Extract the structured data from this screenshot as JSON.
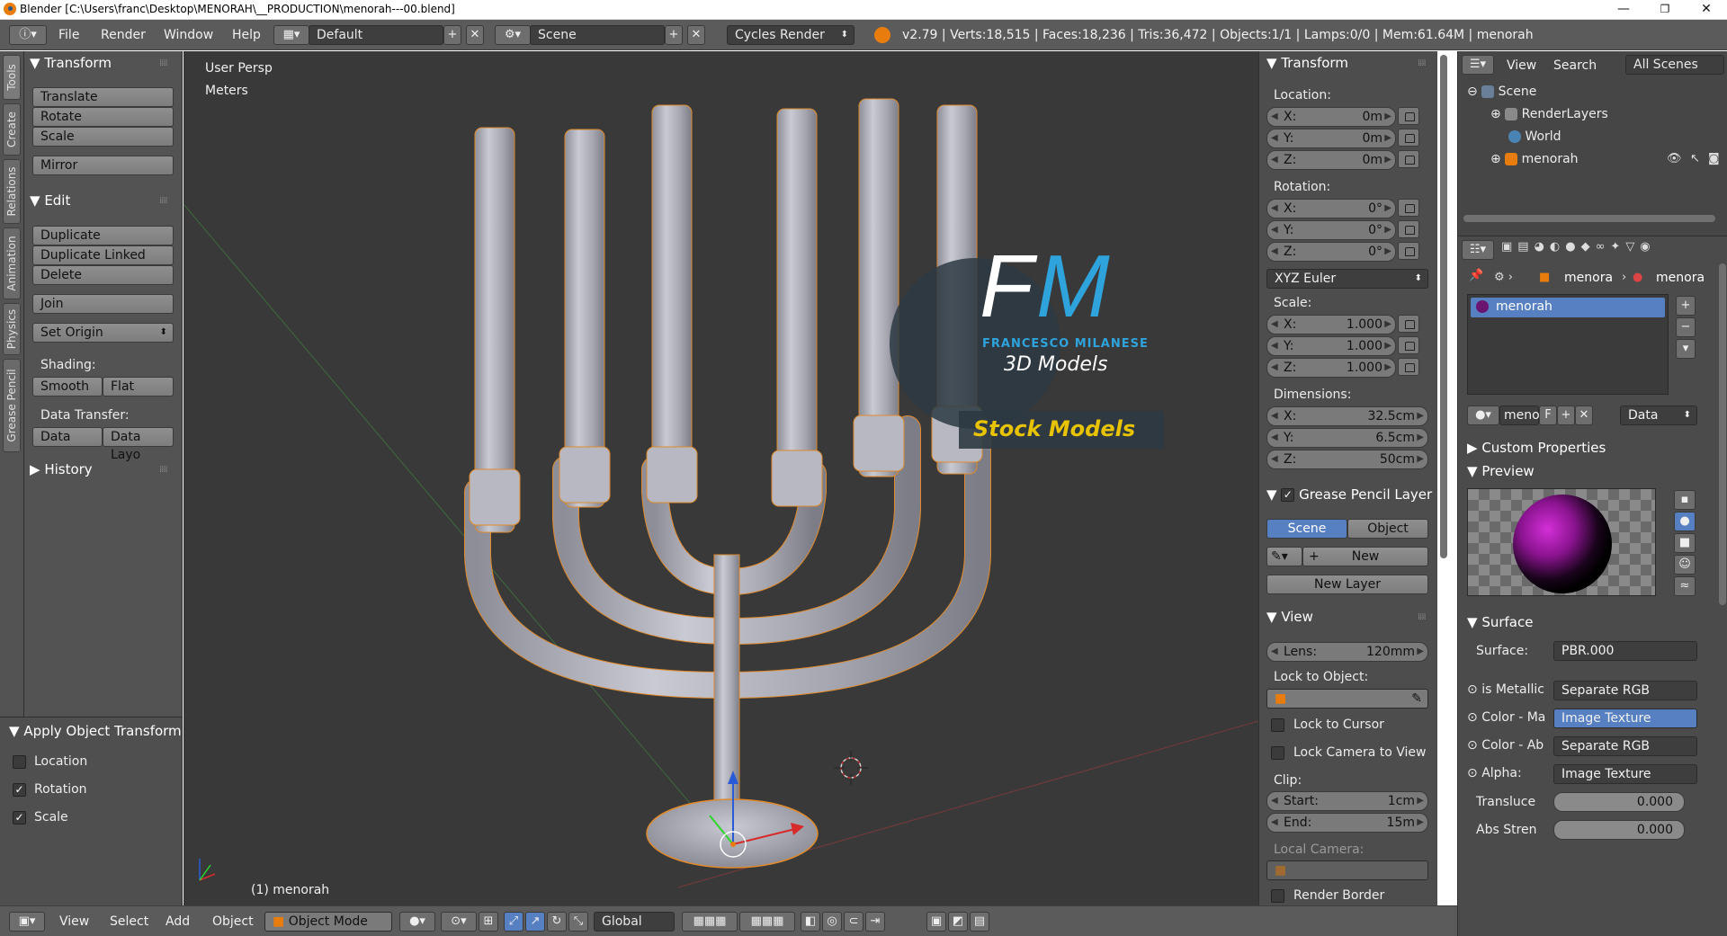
{
  "window": {
    "title": "Blender [C:\\Users\\franc\\Desktop\\MENORAH\\__PRODUCTION\\menorah---00.blend]",
    "minimize": "—",
    "maximize": "❐",
    "close": "✕"
  },
  "infobar": {
    "menus": [
      "File",
      "Render",
      "Window",
      "Help"
    ],
    "screen_layout": "Default",
    "scene": "Scene",
    "render_engine": "Cycles Render",
    "stats": "v2.79 | Verts:18,515 | Faces:18,236 | Tris:36,472 | Objects:1/1 | Lamps:0/0 | Mem:61.64M | menorah"
  },
  "tool_tabs": [
    "Tools",
    "Create",
    "Relations",
    "Animation",
    "Physics",
    "Grease Pencil"
  ],
  "toolshelf": {
    "transform_title": "Transform",
    "transform_buttons": [
      "Translate",
      "Rotate",
      "Scale"
    ],
    "mirror": "Mirror",
    "edit_title": "Edit",
    "edit_buttons": [
      "Duplicate",
      "Duplicate Linked",
      "Delete"
    ],
    "join": "Join",
    "set_origin": "Set Origin",
    "shading_label": "Shading:",
    "smooth": "Smooth",
    "flat": "Flat",
    "data_transfer_label": "Data Transfer:",
    "data": "Data",
    "data_layout": "Data Layo",
    "history": "History"
  },
  "operator": {
    "title": "Apply Object Transform",
    "options": [
      {
        "label": "Location",
        "checked": false
      },
      {
        "label": "Rotation",
        "checked": true
      },
      {
        "label": "Scale",
        "checked": true
      }
    ]
  },
  "viewport": {
    "view_name": "User Persp",
    "units": "Meters",
    "object_label": "(1) menorah",
    "watermark_initials_f": "F",
    "watermark_initials_m": "M",
    "watermark_name": "FRANCESCO MILANESE",
    "watermark_sub": "3D Models",
    "watermark_banner": "Stock Models"
  },
  "bottombar": {
    "menus": [
      "View",
      "Select",
      "Add",
      "Object"
    ],
    "mode": "Object Mode",
    "orientation": "Global"
  },
  "npanel": {
    "transform_title": "Transform",
    "location_label": "Location:",
    "location": [
      {
        "axis": "X:",
        "value": "0m"
      },
      {
        "axis": "Y:",
        "value": "0m"
      },
      {
        "axis": "Z:",
        "value": "0m"
      }
    ],
    "rotation_label": "Rotation:",
    "rotation": [
      {
        "axis": "X:",
        "value": "0°"
      },
      {
        "axis": "Y:",
        "value": "0°"
      },
      {
        "axis": "Z:",
        "value": "0°"
      }
    ],
    "rotation_mode": "XYZ Euler",
    "scale_label": "Scale:",
    "scale": [
      {
        "axis": "X:",
        "value": "1.000"
      },
      {
        "axis": "Y:",
        "value": "1.000"
      },
      {
        "axis": "Z:",
        "value": "1.000"
      }
    ],
    "dimensions_label": "Dimensions:",
    "dimensions": [
      {
        "axis": "X:",
        "value": "32.5cm"
      },
      {
        "axis": "Y:",
        "value": "6.5cm"
      },
      {
        "axis": "Z:",
        "value": "50cm"
      }
    ],
    "gp_title": "Grease Pencil Layer",
    "gp_scene": "Scene",
    "gp_object": "Object",
    "gp_new": "New",
    "gp_new_layer": "New Layer",
    "view_title": "View",
    "lens_label": "Lens:",
    "lens_value": "120mm",
    "lock_to_object": "Lock to Object:",
    "lock_to_cursor": "Lock to Cursor",
    "lock_camera": "Lock Camera to View",
    "clip_label": "Clip:",
    "clip_start_label": "Start:",
    "clip_start": "1cm",
    "clip_end_label": "End:",
    "clip_end": "15m",
    "local_camera": "Local Camera:",
    "render_border": "Render Border"
  },
  "outliner": {
    "view": "View",
    "search": "Search",
    "filter": "All Scenes",
    "items": [
      "Scene",
      "RenderLayers",
      "World",
      "menorah"
    ]
  },
  "properties": {
    "breadcrumb_obj": "menora",
    "breadcrumb_mat": "menora",
    "material_slot": "menorah",
    "mat_name": "meno",
    "mat_fake": "F",
    "link": "Data",
    "custom_props": "Custom Properties",
    "preview": "Preview",
    "surface_title": "Surface",
    "surface_label": "Surface:",
    "surface_value": "PBR.000",
    "rows": [
      {
        "label": "is Metallic",
        "value": "Separate RGB"
      },
      {
        "label": "Color - Ma",
        "value": "Image Texture"
      },
      {
        "label": "Color - Ab",
        "value": "Separate RGB"
      },
      {
        "label": "Alpha:",
        "value": "Image Texture"
      }
    ],
    "translucency_label": "Transluce",
    "translucency": "0.000",
    "abs_label": "Abs Stren",
    "abs": "0.000"
  },
  "colors": {
    "accent_blue": "#5680c2",
    "theme_gray": "#5b5b5b",
    "viewport_bg": "#393939",
    "logo_blue": "#2ea3dc",
    "banner_yellow": "#e8c300"
  }
}
